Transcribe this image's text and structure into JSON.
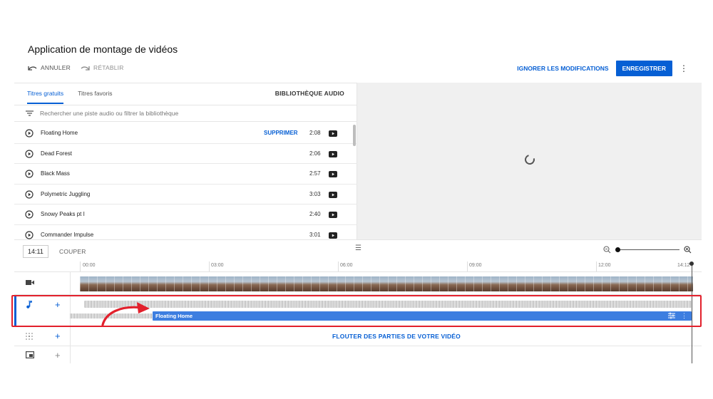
{
  "header": {
    "title": "Application de montage de vidéos",
    "undo_label": "ANNULER",
    "redo_label": "RÉTABLIR",
    "discard_label": "IGNORER LES MODIFICATIONS",
    "save_label": "ENREGISTRER"
  },
  "library": {
    "tabs": [
      {
        "label": "Titres gratuits",
        "active": true
      },
      {
        "label": "Titres favoris",
        "active": false
      }
    ],
    "title": "BIBLIOTHÈQUE AUDIO",
    "search_placeholder": "Rechercher une piste audio ou filtrer la bibliothèque",
    "remove_label": "SUPPRIMER",
    "tracks": [
      {
        "name": "Floating Home",
        "duration": "2:08",
        "selected": true
      },
      {
        "name": "Dead Forest",
        "duration": "2:06"
      },
      {
        "name": "Black Mass",
        "duration": "2:57"
      },
      {
        "name": "Polymetric Juggling",
        "duration": "3:03"
      },
      {
        "name": "Snowy Peaks pt I",
        "duration": "2:40"
      },
      {
        "name": "Commander Impulse",
        "duration": "3:01"
      }
    ]
  },
  "timeline": {
    "current_time": "14:11",
    "cut_label": "COUPER",
    "ruler": [
      "00:00",
      "03:00",
      "06:00",
      "09:00",
      "12:00",
      "14:12"
    ],
    "audio_clip_label": "Floating Home",
    "blur_label": "FLOUTER DES PARTIES DE VOTRE VIDÉO"
  },
  "colors": {
    "accent": "#065fd4",
    "highlight": "#e2202c"
  },
  "icons": {
    "undo": "undo-icon",
    "redo": "redo-icon",
    "filter": "filter-icon",
    "play": "play-circle-icon",
    "youtube": "youtube-icon",
    "zoom_out": "zoom-out-icon",
    "zoom_in": "zoom-in-icon",
    "video_track": "video-camera-icon",
    "audio_track": "music-note-icon",
    "blur_track": "blur-icon",
    "endscreen_track": "end-screen-icon"
  }
}
